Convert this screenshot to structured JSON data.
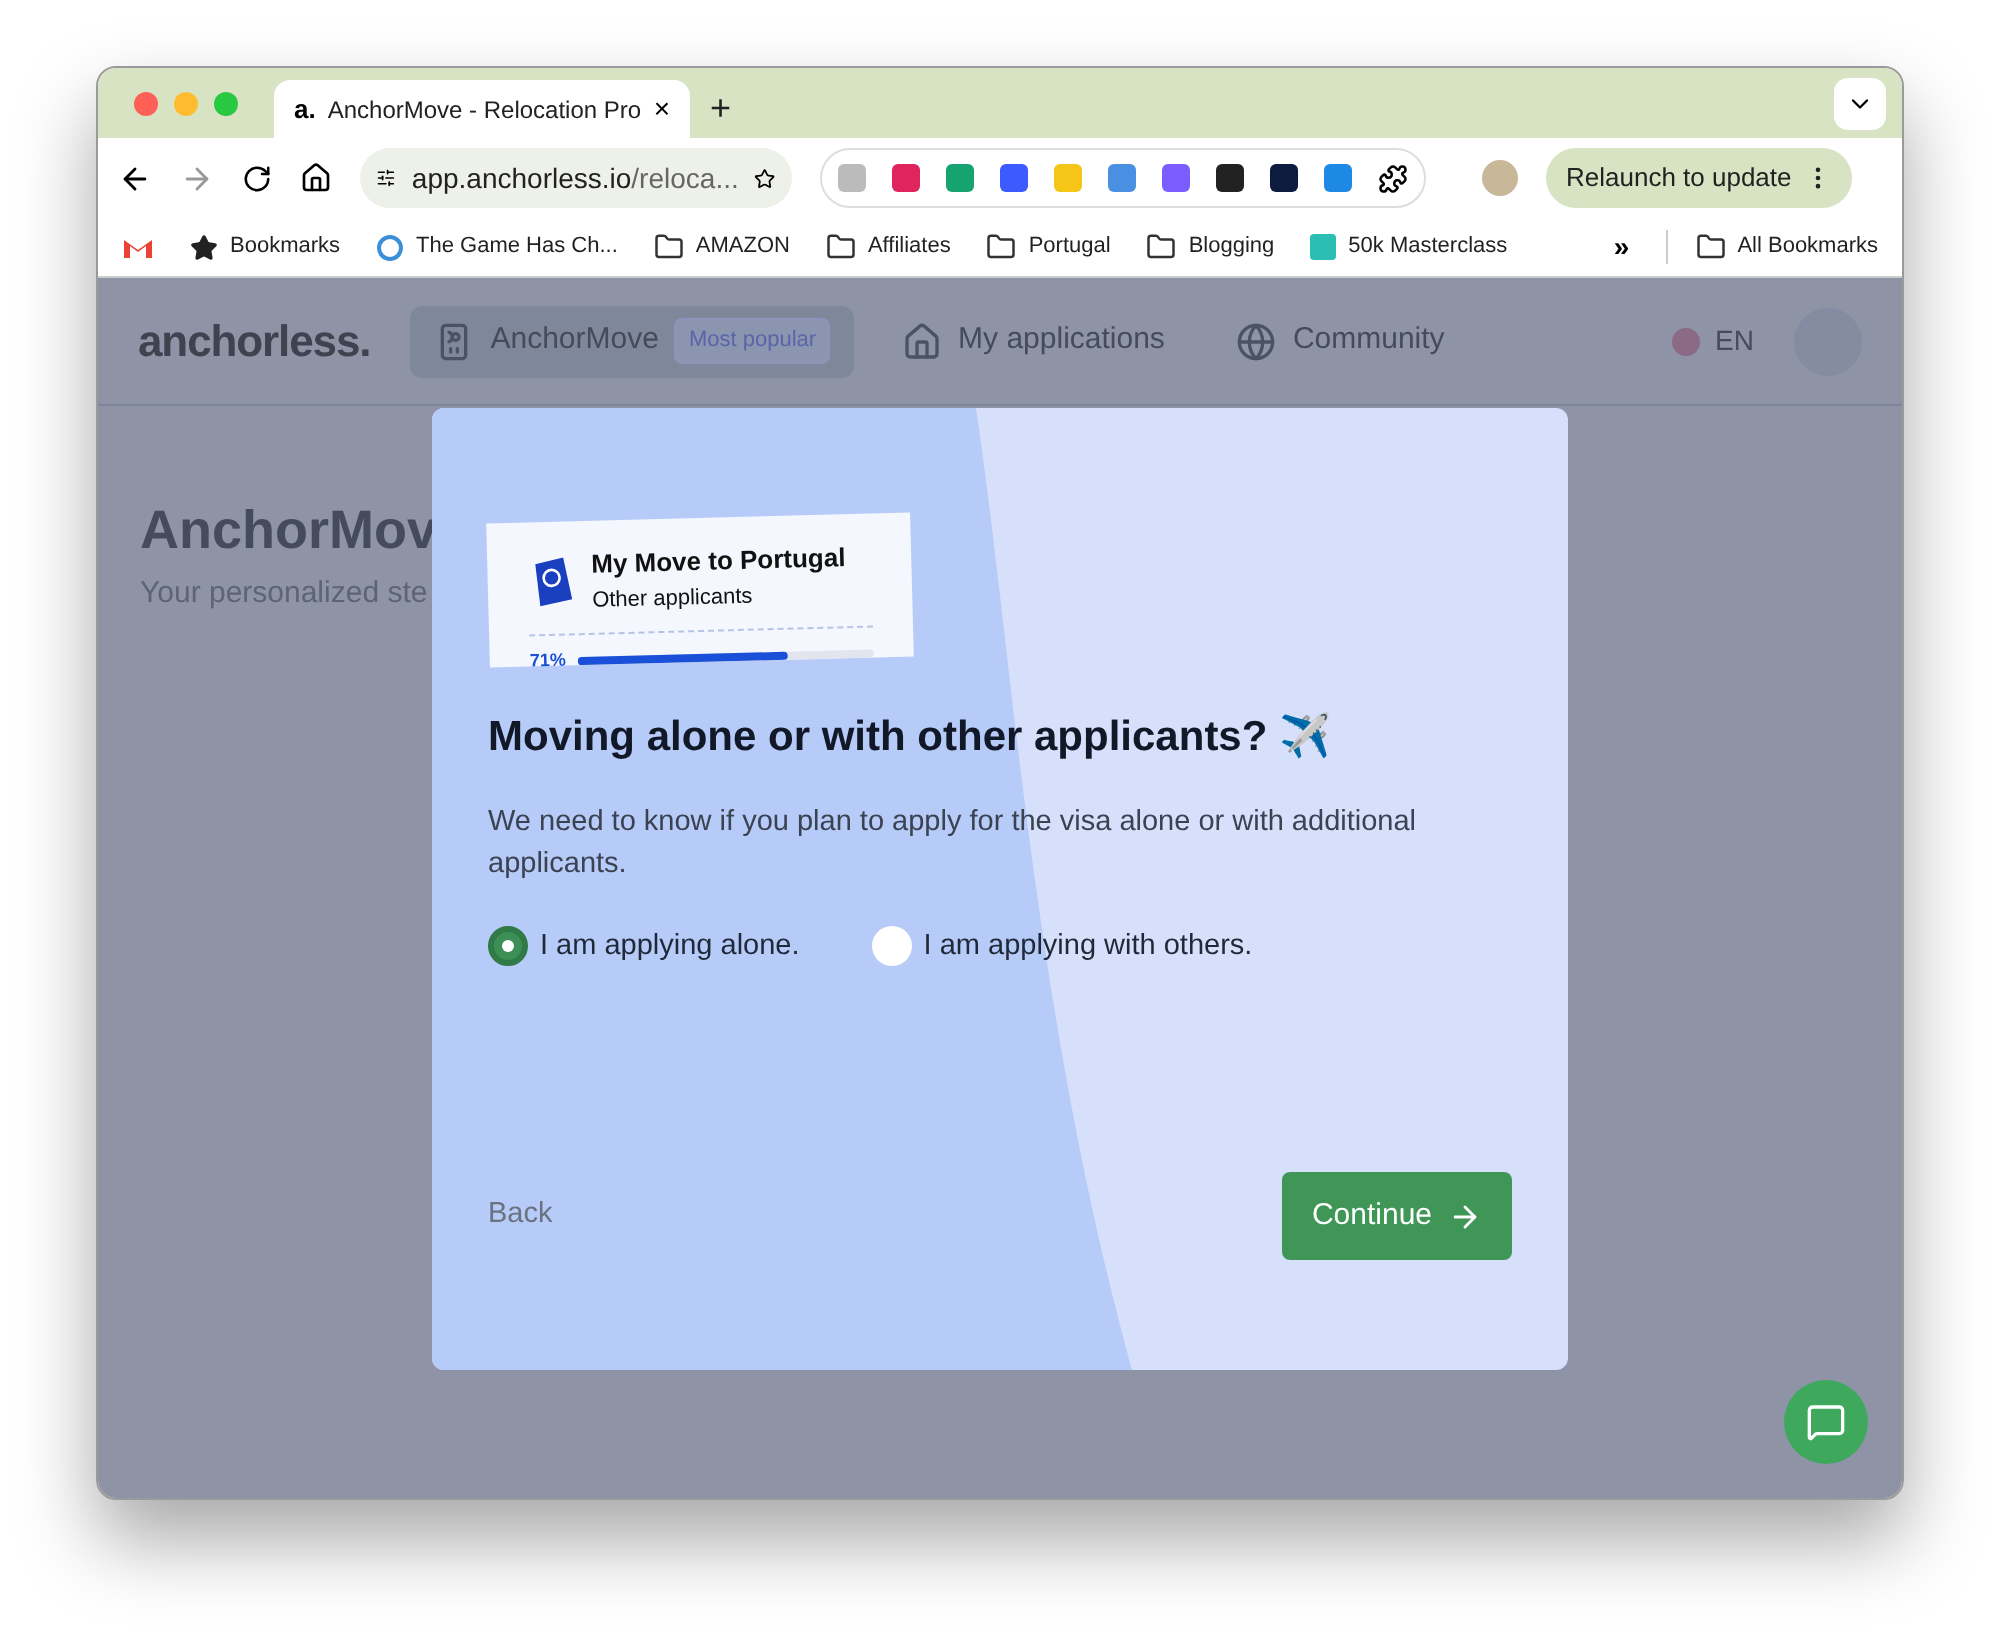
{
  "browser": {
    "tab_title": "AnchorMove - Relocation Pro",
    "tab_favicon": "a.",
    "tab_close": "×",
    "new_tab": "+",
    "url_host": "app.anchorless.io",
    "url_path": "/reloca...",
    "relaunch": "Relaunch to update",
    "bookmarks": [
      {
        "kind": "gmail"
      },
      {
        "kind": "star",
        "label": "Bookmarks"
      },
      {
        "kind": "circle",
        "label": "The Game Has Ch..."
      },
      {
        "kind": "folder",
        "label": "AMAZON"
      },
      {
        "kind": "folder",
        "label": "Affiliates"
      },
      {
        "kind": "folder",
        "label": "Portugal"
      },
      {
        "kind": "folder",
        "label": "Blogging"
      },
      {
        "kind": "site",
        "label": "50k Masterclass"
      }
    ],
    "overflow": "»",
    "all_bookmarks": "All Bookmarks"
  },
  "header": {
    "logo": "anchorless.",
    "nav": [
      {
        "kind": "product",
        "label": "AnchorMove",
        "badge": "Most popular",
        "selected": true
      },
      {
        "kind": "home",
        "label": "My applications",
        "selected": false
      },
      {
        "kind": "globe",
        "label": "Community",
        "selected": false
      }
    ],
    "language": "EN"
  },
  "page": {
    "title": "AnchorMov",
    "subtitle": "Your personalized ste"
  },
  "modal": {
    "ticket": {
      "title": "My Move to Portugal",
      "subtitle": "Other applicants",
      "percent": "71%",
      "level": 0.71
    },
    "heading": "Moving alone or with other applicants? ✈️",
    "description": "We need to know if you plan to apply for the visa alone or with additional applicants.",
    "options": [
      {
        "label": "I am applying alone.",
        "selected": true
      },
      {
        "label": "I am applying with others.",
        "selected": false
      }
    ],
    "back": "Back",
    "continue": "Continue"
  }
}
